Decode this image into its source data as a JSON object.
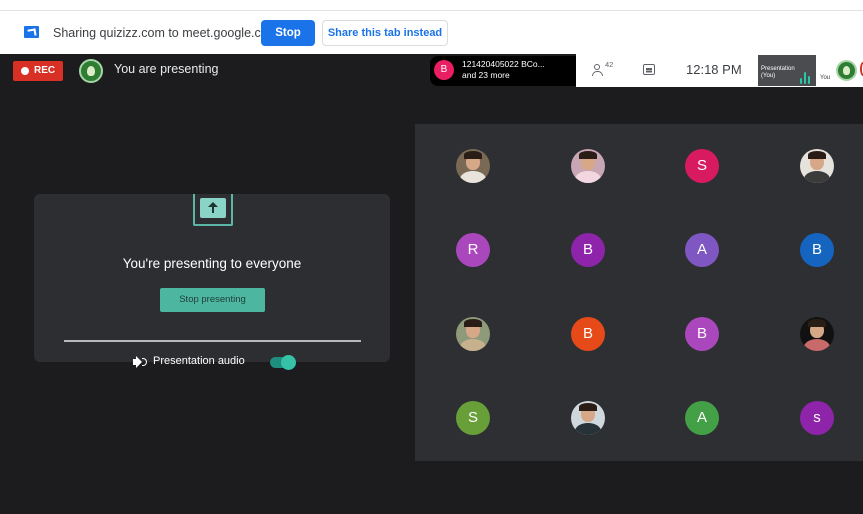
{
  "share_bar": {
    "message": "Sharing quizizz.com to meet.google.com",
    "stop_label": "Stop",
    "share_tab_label": "Share this tab instead"
  },
  "meet_header": {
    "rec_label": "REC",
    "presenting_label": "You are presenting"
  },
  "participants_pill": {
    "avatar_letter": "B",
    "line1": "121420405022 BCo...",
    "line2": "and 23 more"
  },
  "controls": {
    "people_count": "42",
    "clock": "12:18 PM",
    "presentation_tile_label": "Presentation (You)",
    "you_tile_label": "You"
  },
  "presenting_card": {
    "title": "You're presenting to everyone",
    "stop_presenting_label": "Stop presenting",
    "audio_label": "Presentation audio",
    "audio_enabled": true
  },
  "participant_grid": {
    "tiles": [
      {
        "type": "photo",
        "letter": "",
        "color": "#7a6a55",
        "shirt": "#e8e4dc"
      },
      {
        "type": "photo",
        "letter": "",
        "color": "#c9a6b4",
        "shirt": "#f2d7e0"
      },
      {
        "type": "letter",
        "letter": "S",
        "color": "#d81b60"
      },
      {
        "type": "photo",
        "letter": "",
        "color": "#e6e2dc",
        "shirt": "#3b3b3b"
      },
      {
        "type": "letter",
        "letter": "R",
        "color": "#ab47bc"
      },
      {
        "type": "letter",
        "letter": "B",
        "color": "#8e24aa"
      },
      {
        "type": "letter",
        "letter": "A",
        "color": "#7e57c2"
      },
      {
        "type": "letter",
        "letter": "B",
        "color": "#1565c0"
      },
      {
        "type": "photo",
        "letter": "",
        "color": "#8e9a7a",
        "shirt": "#c7b08c"
      },
      {
        "type": "letter",
        "letter": "B",
        "color": "#e64a19"
      },
      {
        "type": "letter",
        "letter": "B",
        "color": "#ab47bc"
      },
      {
        "type": "photo",
        "letter": "",
        "color": "#111111",
        "shirt": "#c96a6a"
      },
      {
        "type": "letter",
        "letter": "S",
        "color": "#689f38"
      },
      {
        "type": "photo",
        "letter": "",
        "color": "#cfd8dc",
        "shirt": "#263238"
      },
      {
        "type": "letter",
        "letter": "A",
        "color": "#43a047"
      },
      {
        "type": "letter",
        "letter": "s",
        "color": "#8e24aa"
      }
    ]
  }
}
